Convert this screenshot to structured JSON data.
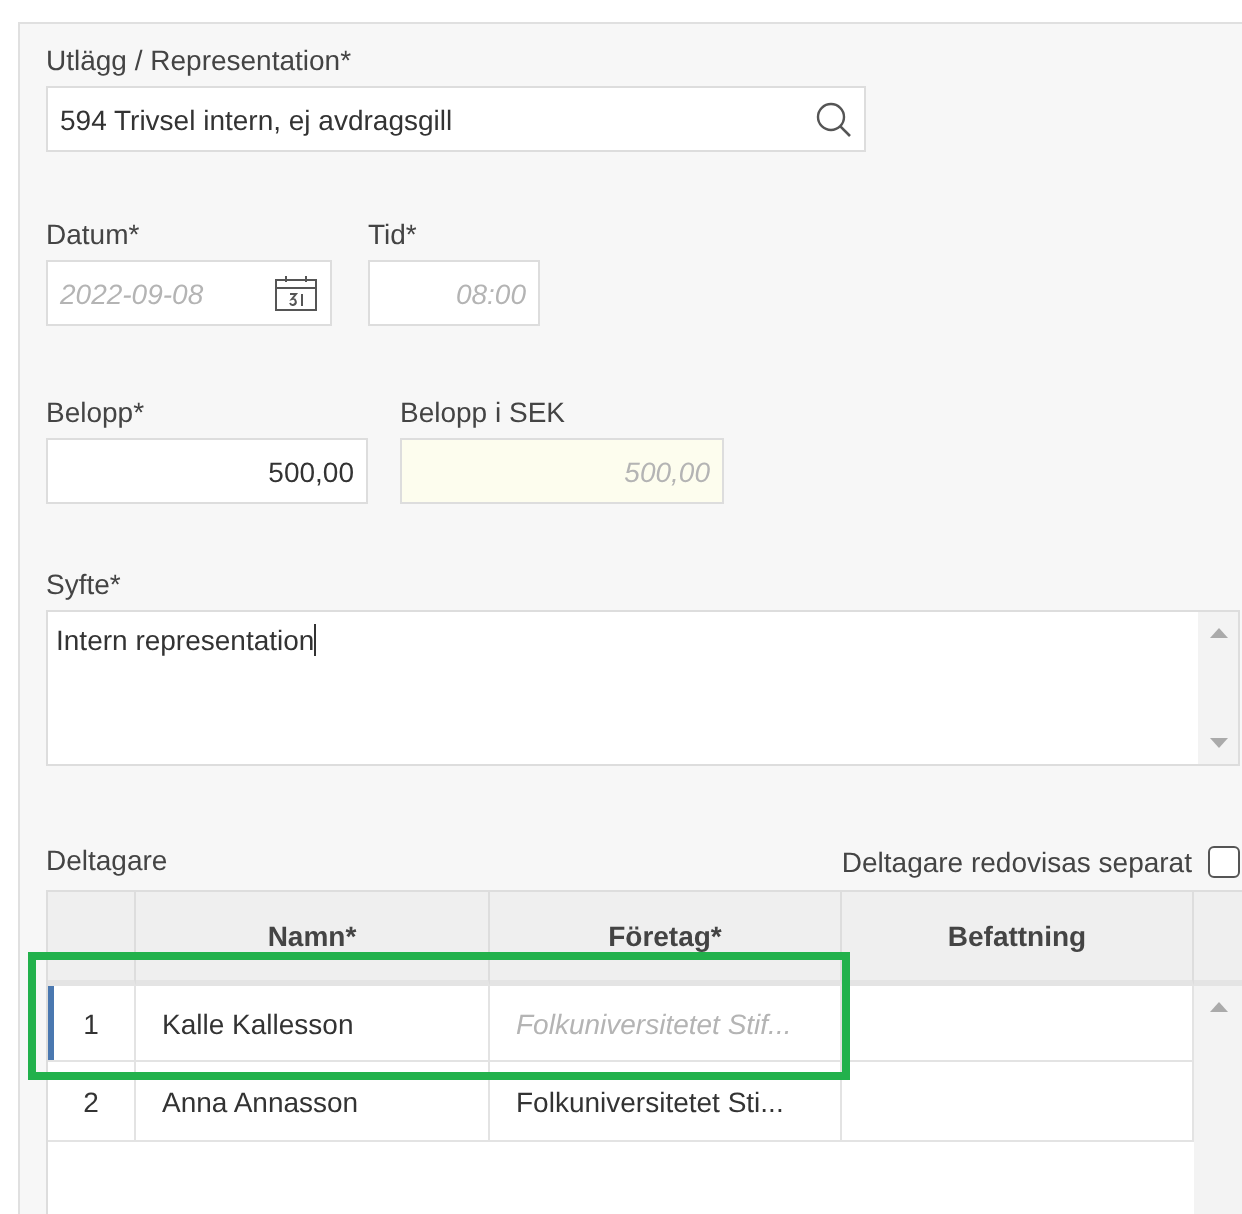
{
  "expense": {
    "label": "Utlägg / Representation*",
    "value": "594 Trivsel intern, ej avdragsgill"
  },
  "date": {
    "label": "Datum*",
    "value": "2022-09-08",
    "readonly": true
  },
  "time": {
    "label": "Tid*",
    "value": "08:00",
    "readonly": true
  },
  "amount": {
    "label": "Belopp*",
    "value": "500,00"
  },
  "amount_sek": {
    "label": "Belopp i SEK",
    "value": "500,00",
    "readonly": true,
    "tinted": true
  },
  "purpose": {
    "label": "Syfte*",
    "value": "Intern representation"
  },
  "participants": {
    "label": "Deltagare",
    "separate_label": "Deltagare redovisas separat",
    "separate_checked": false,
    "columns": [
      "Namn*",
      "Företag*",
      "Befattning"
    ],
    "rows": [
      {
        "number": "1",
        "name": "Kalle Kallesson",
        "company": "Folkuniversitetet Stif...",
        "selected": true,
        "highlighted": true
      },
      {
        "number": "2",
        "name": "Anna Annasson",
        "company": "Folkuniversitetet Sti...",
        "selected": false,
        "highlighted": false
      }
    ]
  }
}
